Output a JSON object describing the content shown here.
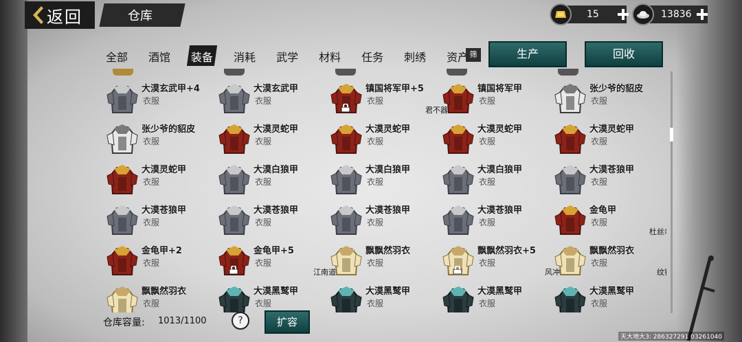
{
  "header": {
    "back_label": "返回",
    "title": "仓库",
    "gold": "15",
    "silver": "13836"
  },
  "tabs": [
    {
      "label": "全部",
      "active": false
    },
    {
      "label": "酒馆",
      "active": false
    },
    {
      "label": "装备",
      "active": true
    },
    {
      "label": "消耗",
      "active": false
    },
    {
      "label": "武学",
      "active": false
    },
    {
      "label": "材料",
      "active": false
    },
    {
      "label": "任务",
      "active": false
    },
    {
      "label": "刺绣",
      "active": false
    },
    {
      "label": "资产",
      "active": false
    }
  ],
  "filter_label": "筛",
  "actions": {
    "produce": "生产",
    "recycle": "回收"
  },
  "items": [
    {
      "name": "大漠玄武甲+4",
      "type": "衣服",
      "icon": "gray-fur-armor",
      "locked": false,
      "owner": ""
    },
    {
      "name": "大漠玄武甲",
      "type": "衣服",
      "icon": "gray-fur-armor",
      "locked": false,
      "owner": ""
    },
    {
      "name": "镇国将军甲+5",
      "type": "衣服",
      "icon": "red-gold-armor",
      "locked": true,
      "owner": "君不器"
    },
    {
      "name": "镇国将军甲",
      "type": "衣服",
      "icon": "red-gold-armor",
      "locked": false,
      "owner": ""
    },
    {
      "name": "张少爷的貂皮",
      "type": "衣服",
      "icon": "white-fur-coat",
      "locked": false,
      "owner": ""
    },
    {
      "name": "张少爷的貂皮",
      "type": "衣服",
      "icon": "white-fur-coat",
      "locked": false,
      "owner": ""
    },
    {
      "name": "大漠灵蛇甲",
      "type": "衣服",
      "icon": "red-gold-armor",
      "locked": false,
      "owner": ""
    },
    {
      "name": "大漠灵蛇甲",
      "type": "衣服",
      "icon": "red-gold-armor",
      "locked": false,
      "owner": ""
    },
    {
      "name": "大漠灵蛇甲",
      "type": "衣服",
      "icon": "red-gold-armor",
      "locked": false,
      "owner": ""
    },
    {
      "name": "大漠灵蛇甲",
      "type": "衣服",
      "icon": "red-gold-armor",
      "locked": false,
      "owner": ""
    },
    {
      "name": "大漠灵蛇甲",
      "type": "衣服",
      "icon": "red-gold-armor",
      "locked": false,
      "owner": ""
    },
    {
      "name": "大漠白狼甲",
      "type": "衣服",
      "icon": "gray-fur-armor",
      "locked": false,
      "owner": ""
    },
    {
      "name": "大漠白狼甲",
      "type": "衣服",
      "icon": "gray-fur-armor",
      "locked": false,
      "owner": ""
    },
    {
      "name": "大漠白狼甲",
      "type": "衣服",
      "icon": "gray-fur-armor",
      "locked": false,
      "owner": ""
    },
    {
      "name": "大漠苍狼甲",
      "type": "衣服",
      "icon": "gray-fur-armor",
      "locked": false,
      "owner": ""
    },
    {
      "name": "大漠苍狼甲",
      "type": "衣服",
      "icon": "gray-fur-armor",
      "locked": false,
      "owner": ""
    },
    {
      "name": "大漠苍狼甲",
      "type": "衣服",
      "icon": "gray-fur-armor",
      "locked": false,
      "owner": ""
    },
    {
      "name": "大漠苍狼甲",
      "type": "衣服",
      "icon": "gray-fur-armor",
      "locked": false,
      "owner": ""
    },
    {
      "name": "大漠苍狼甲",
      "type": "衣服",
      "icon": "gray-fur-armor",
      "locked": false,
      "owner": ""
    },
    {
      "name": "金龟甲",
      "type": "衣服",
      "icon": "red-gold-armor",
      "locked": false,
      "owner": "杜丝尔"
    },
    {
      "name": "金龟甲+2",
      "type": "衣服",
      "icon": "red-gold-armor",
      "locked": false,
      "owner": ""
    },
    {
      "name": "金龟甲+5",
      "type": "衣服",
      "icon": "red-gold-armor",
      "locked": true,
      "owner": "江南道"
    },
    {
      "name": "飘飘然羽衣",
      "type": "衣服",
      "icon": "cream-robe",
      "locked": false,
      "owner": ""
    },
    {
      "name": "飘飘然羽衣+5",
      "type": "衣服",
      "icon": "cream-robe",
      "locked": true,
      "owner": "风冲"
    },
    {
      "name": "飘飘然羽衣",
      "type": "衣服",
      "icon": "cream-robe",
      "locked": false,
      "owner": "纹银"
    },
    {
      "name": "飘飘然羽衣",
      "type": "衣服",
      "icon": "cream-robe",
      "locked": false,
      "owner": ""
    },
    {
      "name": "大漠黑鹫甲",
      "type": "衣服",
      "icon": "dark-teal-armor",
      "locked": false,
      "owner": ""
    },
    {
      "name": "大漠黑鹫甲",
      "type": "衣服",
      "icon": "dark-teal-armor",
      "locked": false,
      "owner": ""
    },
    {
      "name": "大漠黑鹫甲",
      "type": "衣服",
      "icon": "dark-teal-armor",
      "locked": false,
      "owner": ""
    },
    {
      "name": "大漠黑鹫甲",
      "type": "衣服",
      "icon": "dark-teal-armor",
      "locked": false,
      "owner": ""
    }
  ],
  "capacity": {
    "label": "仓库容量:",
    "value": "1013/1100"
  },
  "help_label": "?",
  "expand_label": "扩容",
  "watermark": "天大地大3: 286327291  03261040"
}
